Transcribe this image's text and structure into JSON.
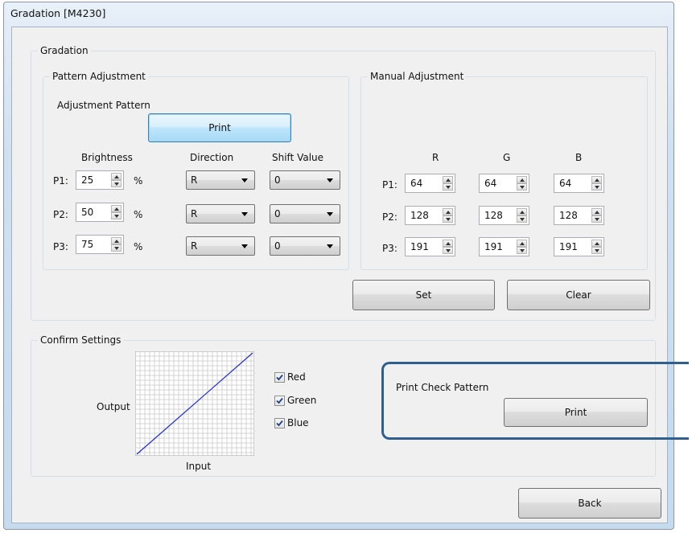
{
  "window": {
    "title": "Gradation [M4230]"
  },
  "gradation": {
    "group_label": "Gradation",
    "pattern_adjustment": {
      "group_label": "Pattern Adjustment",
      "adjustment_pattern_label": "Adjustment Pattern",
      "print_label": "Print",
      "headers": {
        "brightness": "Brightness",
        "direction": "Direction",
        "shift_value": "Shift Value"
      },
      "rows": [
        {
          "label": "P1:",
          "brightness": "25",
          "unit": "%",
          "direction": "R",
          "shift": "0"
        },
        {
          "label": "P2:",
          "brightness": "50",
          "unit": "%",
          "direction": "R",
          "shift": "0"
        },
        {
          "label": "P3:",
          "brightness": "75",
          "unit": "%",
          "direction": "R",
          "shift": "0"
        }
      ]
    },
    "manual_adjustment": {
      "group_label": "Manual Adjustment",
      "headers": {
        "r": "R",
        "g": "G",
        "b": "B"
      },
      "rows": [
        {
          "label": "P1:",
          "r": "64",
          "g": "64",
          "b": "64"
        },
        {
          "label": "P2:",
          "r": "128",
          "g": "128",
          "b": "128"
        },
        {
          "label": "P3:",
          "r": "191",
          "g": "191",
          "b": "191"
        }
      ]
    },
    "set_label": "Set",
    "clear_label": "Clear"
  },
  "confirm": {
    "group_label": "Confirm Settings",
    "output_label": "Output",
    "input_label": "Input",
    "checkboxes": [
      {
        "label": "Red",
        "checked": true
      },
      {
        "label": "Green",
        "checked": true
      },
      {
        "label": "Blue",
        "checked": true
      }
    ],
    "print_check_label": "Print Check Pattern",
    "print_label": "Print",
    "curve_color": "#1f2bd6"
  },
  "back_label": "Back",
  "colors": {
    "callout_border": "#2f5f8f",
    "focus_button": "#3c7fb1"
  }
}
